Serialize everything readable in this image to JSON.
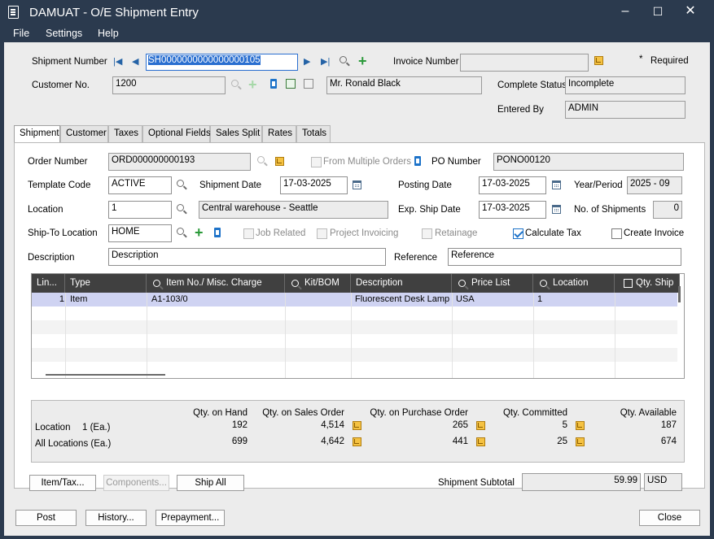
{
  "window": {
    "title": "DAMUAT - O/E Shipment Entry",
    "minimize": "–",
    "maximize": "☐",
    "close": "✕"
  },
  "menu": {
    "file": "File",
    "settings": "Settings",
    "help": "Help"
  },
  "header": {
    "shipment_number_label": "Shipment Number",
    "shipment_number": "SH0000000000000000105",
    "invoice_number_label": "Invoice Number",
    "invoice_number": "",
    "required_label": "Required",
    "customer_no_label": "Customer No.",
    "customer_no": "1200",
    "customer_name": "Mr. Ronald Black",
    "complete_status_label": "Complete Status",
    "complete_status": "Incomplete",
    "entered_by_label": "Entered By",
    "entered_by": "ADMIN"
  },
  "tabs": [
    "Shipment",
    "Customer",
    "Taxes",
    "Optional Fields",
    "Sales Split",
    "Rates",
    "Totals"
  ],
  "form": {
    "order_number_label": "Order Number",
    "order_number": "ORD000000000193",
    "from_multiple_orders": "From Multiple Orders",
    "po_number_label": "PO Number",
    "po_number": "PONO00120",
    "template_code_label": "Template Code",
    "template_code": "ACTIVE",
    "shipment_date_label": "Shipment Date",
    "shipment_date": "17-03-2025",
    "posting_date_label": "Posting Date",
    "posting_date": "17-03-2025",
    "year_period_label": "Year/Period",
    "year_period": "2025 - 09",
    "location_label": "Location",
    "location": "1",
    "location_desc": "Central warehouse - Seattle",
    "exp_ship_date_label": "Exp. Ship Date",
    "exp_ship_date": "17-03-2025",
    "no_of_shipments_label": "No. of Shipments",
    "no_of_shipments": "0",
    "ship_to_location_label": "Ship-To Location",
    "ship_to_location": "HOME",
    "job_related": "Job Related",
    "project_invoicing": "Project Invoicing",
    "retainage": "Retainage",
    "calculate_tax": "Calculate Tax",
    "calculate_tax_checked": true,
    "create_invoice": "Create Invoice",
    "create_invoice_checked": false,
    "description_label": "Description",
    "description": "Description",
    "reference_label": "Reference",
    "reference": "Reference"
  },
  "grid": {
    "columns": [
      "Lin...",
      "Type",
      "Item No./ Misc. Charge",
      "Kit/BOM",
      "Description",
      "Price List",
      "Location",
      "Qty. Ship"
    ],
    "rows": [
      {
        "line": "1",
        "type": "Item",
        "item": "A1-103/0",
        "kit": "",
        "description": "Fluorescent Desk Lamp",
        "price_list": "USA",
        "location": "1"
      }
    ]
  },
  "summary": {
    "headers": [
      "Qty. on Hand",
      "Qty. on Sales Order",
      "Qty. on Purchase Order",
      "Qty. Committed",
      "Qty. Available"
    ],
    "location_label": "Location",
    "location_value": "1 (Ea.)",
    "all_locations_label": "All Locations (Ea.)",
    "location_row": [
      "192",
      "4,514",
      "265",
      "5",
      "187"
    ],
    "all_row": [
      "699",
      "4,642",
      "441",
      "25",
      "674"
    ]
  },
  "buttons": {
    "item_tax": "Item/Tax...",
    "components": "Components...",
    "ship_all": "Ship All",
    "post": "Post",
    "history": "History...",
    "prepayment": "Prepayment...",
    "close": "Close"
  },
  "subtotal": {
    "label": "Shipment Subtotal",
    "value": "59.99",
    "currency": "USD"
  }
}
